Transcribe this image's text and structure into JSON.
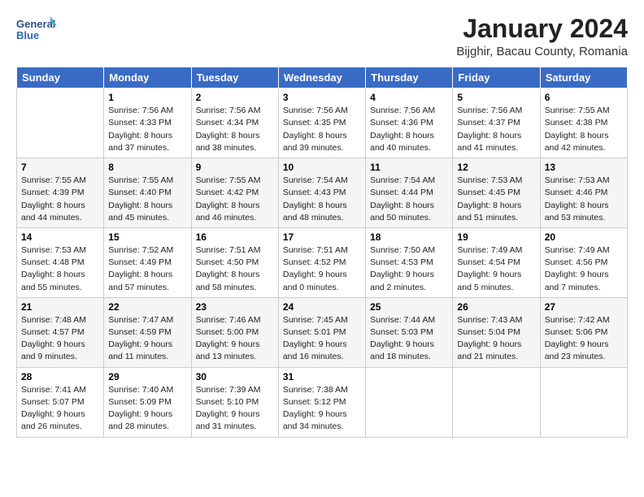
{
  "header": {
    "logo_line1": "General",
    "logo_line2": "Blue",
    "title": "January 2024",
    "subtitle": "Bijghir, Bacau County, Romania"
  },
  "columns": [
    "Sunday",
    "Monday",
    "Tuesday",
    "Wednesday",
    "Thursday",
    "Friday",
    "Saturday"
  ],
  "weeks": [
    [
      {
        "num": "",
        "sunrise": "",
        "sunset": "",
        "daylight": ""
      },
      {
        "num": "1",
        "sunrise": "Sunrise: 7:56 AM",
        "sunset": "Sunset: 4:33 PM",
        "daylight": "Daylight: 8 hours and 37 minutes."
      },
      {
        "num": "2",
        "sunrise": "Sunrise: 7:56 AM",
        "sunset": "Sunset: 4:34 PM",
        "daylight": "Daylight: 8 hours and 38 minutes."
      },
      {
        "num": "3",
        "sunrise": "Sunrise: 7:56 AM",
        "sunset": "Sunset: 4:35 PM",
        "daylight": "Daylight: 8 hours and 39 minutes."
      },
      {
        "num": "4",
        "sunrise": "Sunrise: 7:56 AM",
        "sunset": "Sunset: 4:36 PM",
        "daylight": "Daylight: 8 hours and 40 minutes."
      },
      {
        "num": "5",
        "sunrise": "Sunrise: 7:56 AM",
        "sunset": "Sunset: 4:37 PM",
        "daylight": "Daylight: 8 hours and 41 minutes."
      },
      {
        "num": "6",
        "sunrise": "Sunrise: 7:55 AM",
        "sunset": "Sunset: 4:38 PM",
        "daylight": "Daylight: 8 hours and 42 minutes."
      }
    ],
    [
      {
        "num": "7",
        "sunrise": "Sunrise: 7:55 AM",
        "sunset": "Sunset: 4:39 PM",
        "daylight": "Daylight: 8 hours and 44 minutes."
      },
      {
        "num": "8",
        "sunrise": "Sunrise: 7:55 AM",
        "sunset": "Sunset: 4:40 PM",
        "daylight": "Daylight: 8 hours and 45 minutes."
      },
      {
        "num": "9",
        "sunrise": "Sunrise: 7:55 AM",
        "sunset": "Sunset: 4:42 PM",
        "daylight": "Daylight: 8 hours and 46 minutes."
      },
      {
        "num": "10",
        "sunrise": "Sunrise: 7:54 AM",
        "sunset": "Sunset: 4:43 PM",
        "daylight": "Daylight: 8 hours and 48 minutes."
      },
      {
        "num": "11",
        "sunrise": "Sunrise: 7:54 AM",
        "sunset": "Sunset: 4:44 PM",
        "daylight": "Daylight: 8 hours and 50 minutes."
      },
      {
        "num": "12",
        "sunrise": "Sunrise: 7:53 AM",
        "sunset": "Sunset: 4:45 PM",
        "daylight": "Daylight: 8 hours and 51 minutes."
      },
      {
        "num": "13",
        "sunrise": "Sunrise: 7:53 AM",
        "sunset": "Sunset: 4:46 PM",
        "daylight": "Daylight: 8 hours and 53 minutes."
      }
    ],
    [
      {
        "num": "14",
        "sunrise": "Sunrise: 7:53 AM",
        "sunset": "Sunset: 4:48 PM",
        "daylight": "Daylight: 8 hours and 55 minutes."
      },
      {
        "num": "15",
        "sunrise": "Sunrise: 7:52 AM",
        "sunset": "Sunset: 4:49 PM",
        "daylight": "Daylight: 8 hours and 57 minutes."
      },
      {
        "num": "16",
        "sunrise": "Sunrise: 7:51 AM",
        "sunset": "Sunset: 4:50 PM",
        "daylight": "Daylight: 8 hours and 58 minutes."
      },
      {
        "num": "17",
        "sunrise": "Sunrise: 7:51 AM",
        "sunset": "Sunset: 4:52 PM",
        "daylight": "Daylight: 9 hours and 0 minutes."
      },
      {
        "num": "18",
        "sunrise": "Sunrise: 7:50 AM",
        "sunset": "Sunset: 4:53 PM",
        "daylight": "Daylight: 9 hours and 2 minutes."
      },
      {
        "num": "19",
        "sunrise": "Sunrise: 7:49 AM",
        "sunset": "Sunset: 4:54 PM",
        "daylight": "Daylight: 9 hours and 5 minutes."
      },
      {
        "num": "20",
        "sunrise": "Sunrise: 7:49 AM",
        "sunset": "Sunset: 4:56 PM",
        "daylight": "Daylight: 9 hours and 7 minutes."
      }
    ],
    [
      {
        "num": "21",
        "sunrise": "Sunrise: 7:48 AM",
        "sunset": "Sunset: 4:57 PM",
        "daylight": "Daylight: 9 hours and 9 minutes."
      },
      {
        "num": "22",
        "sunrise": "Sunrise: 7:47 AM",
        "sunset": "Sunset: 4:59 PM",
        "daylight": "Daylight: 9 hours and 11 minutes."
      },
      {
        "num": "23",
        "sunrise": "Sunrise: 7:46 AM",
        "sunset": "Sunset: 5:00 PM",
        "daylight": "Daylight: 9 hours and 13 minutes."
      },
      {
        "num": "24",
        "sunrise": "Sunrise: 7:45 AM",
        "sunset": "Sunset: 5:01 PM",
        "daylight": "Daylight: 9 hours and 16 minutes."
      },
      {
        "num": "25",
        "sunrise": "Sunrise: 7:44 AM",
        "sunset": "Sunset: 5:03 PM",
        "daylight": "Daylight: 9 hours and 18 minutes."
      },
      {
        "num": "26",
        "sunrise": "Sunrise: 7:43 AM",
        "sunset": "Sunset: 5:04 PM",
        "daylight": "Daylight: 9 hours and 21 minutes."
      },
      {
        "num": "27",
        "sunrise": "Sunrise: 7:42 AM",
        "sunset": "Sunset: 5:06 PM",
        "daylight": "Daylight: 9 hours and 23 minutes."
      }
    ],
    [
      {
        "num": "28",
        "sunrise": "Sunrise: 7:41 AM",
        "sunset": "Sunset: 5:07 PM",
        "daylight": "Daylight: 9 hours and 26 minutes."
      },
      {
        "num": "29",
        "sunrise": "Sunrise: 7:40 AM",
        "sunset": "Sunset: 5:09 PM",
        "daylight": "Daylight: 9 hours and 28 minutes."
      },
      {
        "num": "30",
        "sunrise": "Sunrise: 7:39 AM",
        "sunset": "Sunset: 5:10 PM",
        "daylight": "Daylight: 9 hours and 31 minutes."
      },
      {
        "num": "31",
        "sunrise": "Sunrise: 7:38 AM",
        "sunset": "Sunset: 5:12 PM",
        "daylight": "Daylight: 9 hours and 34 minutes."
      },
      {
        "num": "",
        "sunrise": "",
        "sunset": "",
        "daylight": ""
      },
      {
        "num": "",
        "sunrise": "",
        "sunset": "",
        "daylight": ""
      },
      {
        "num": "",
        "sunrise": "",
        "sunset": "",
        "daylight": ""
      }
    ]
  ]
}
